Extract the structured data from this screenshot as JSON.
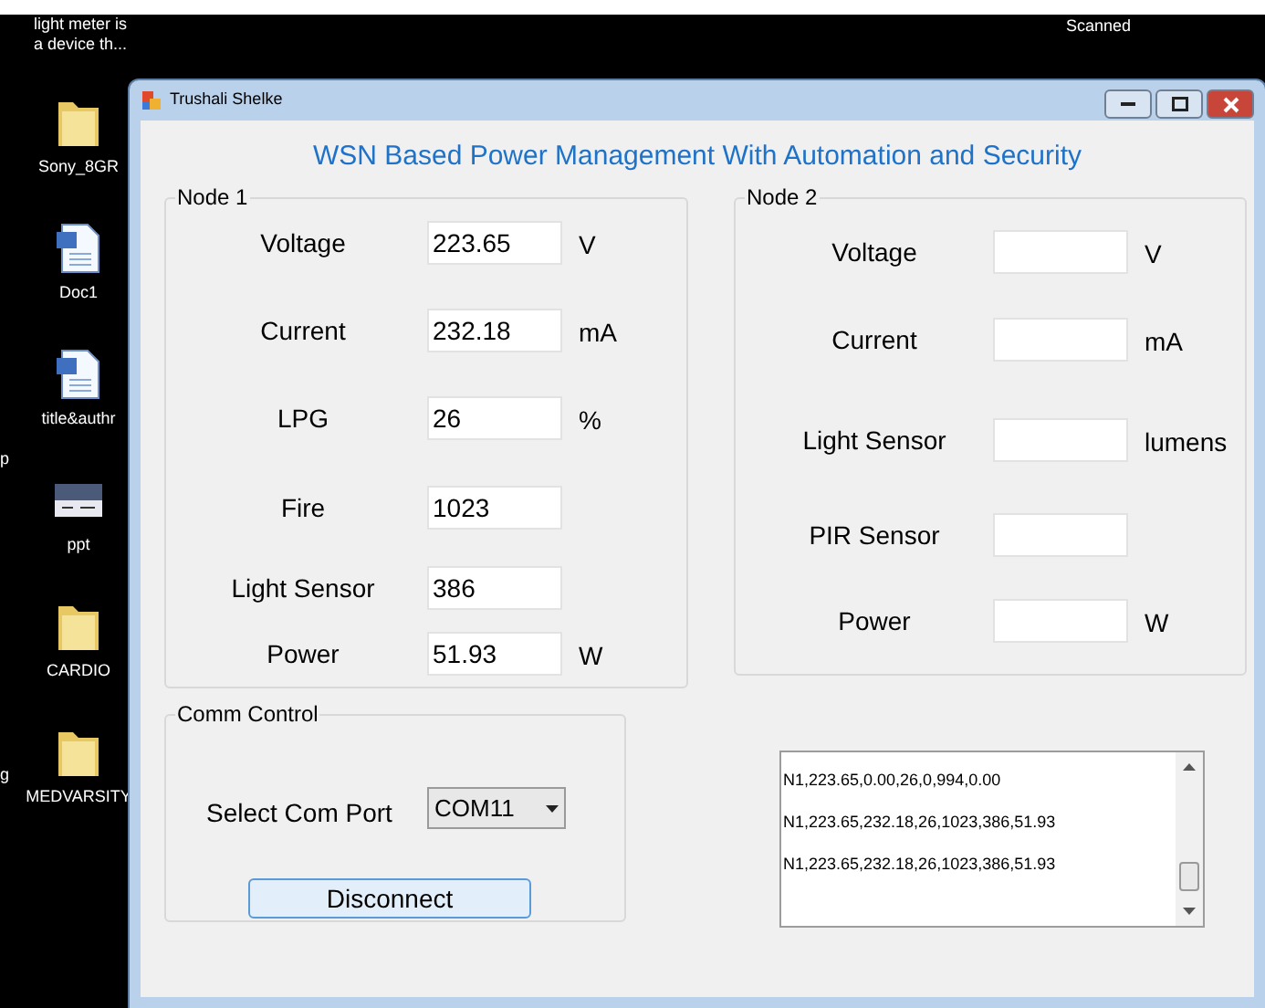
{
  "desktop": {
    "top_texts": [
      {
        "text": "light meter is\na device th..."
      },
      {
        "text": "Scanned"
      }
    ],
    "icons": [
      {
        "kind": "folder",
        "label": "Sony_8GR"
      },
      {
        "kind": "document",
        "label": "Doc1"
      },
      {
        "kind": "document",
        "label": "title&authr"
      },
      {
        "kind": "slides",
        "label": "ppt"
      },
      {
        "kind": "folder",
        "label": "CARDIO"
      },
      {
        "kind": "folder",
        "label": "MEDVARSITY"
      }
    ],
    "edge_fragments": [
      "p",
      "g"
    ]
  },
  "window": {
    "title": "Trushali Shelke",
    "heading": "WSN Based Power Management With Automation and Security",
    "node_1": {
      "title": "Node 1",
      "rows": [
        {
          "label": "Voltage",
          "value": "223.65",
          "unit": "V"
        },
        {
          "label": "Current",
          "value": "232.18",
          "unit": "mA"
        },
        {
          "label": "LPG",
          "value": "26",
          "unit": "%"
        },
        {
          "label": "Fire",
          "value": "1023"
        },
        {
          "label": "Light Sensor",
          "value": "386"
        },
        {
          "label": "Power",
          "value": "51.93",
          "unit": "W"
        }
      ]
    },
    "node_2": {
      "title": "Node 2",
      "rows": [
        {
          "label": "Voltage",
          "unit": "V"
        },
        {
          "label": "Current",
          "unit": "mA"
        },
        {
          "label": "Light Sensor",
          "unit": "lumens"
        },
        {
          "label": "PIR Sensor"
        },
        {
          "label": "Power",
          "unit": "W"
        }
      ]
    },
    "comm_control": {
      "title": "Comm Control",
      "label": "Select Com Port",
      "port": "COM11",
      "button": "Disconnect"
    },
    "log": [
      "N1,223.65,0.00,26,0,994,0.00",
      "N1,223.65,232.18,26,1023,386,51.93",
      "N1,223.65,232.18,26,1023,386,51.93"
    ]
  }
}
